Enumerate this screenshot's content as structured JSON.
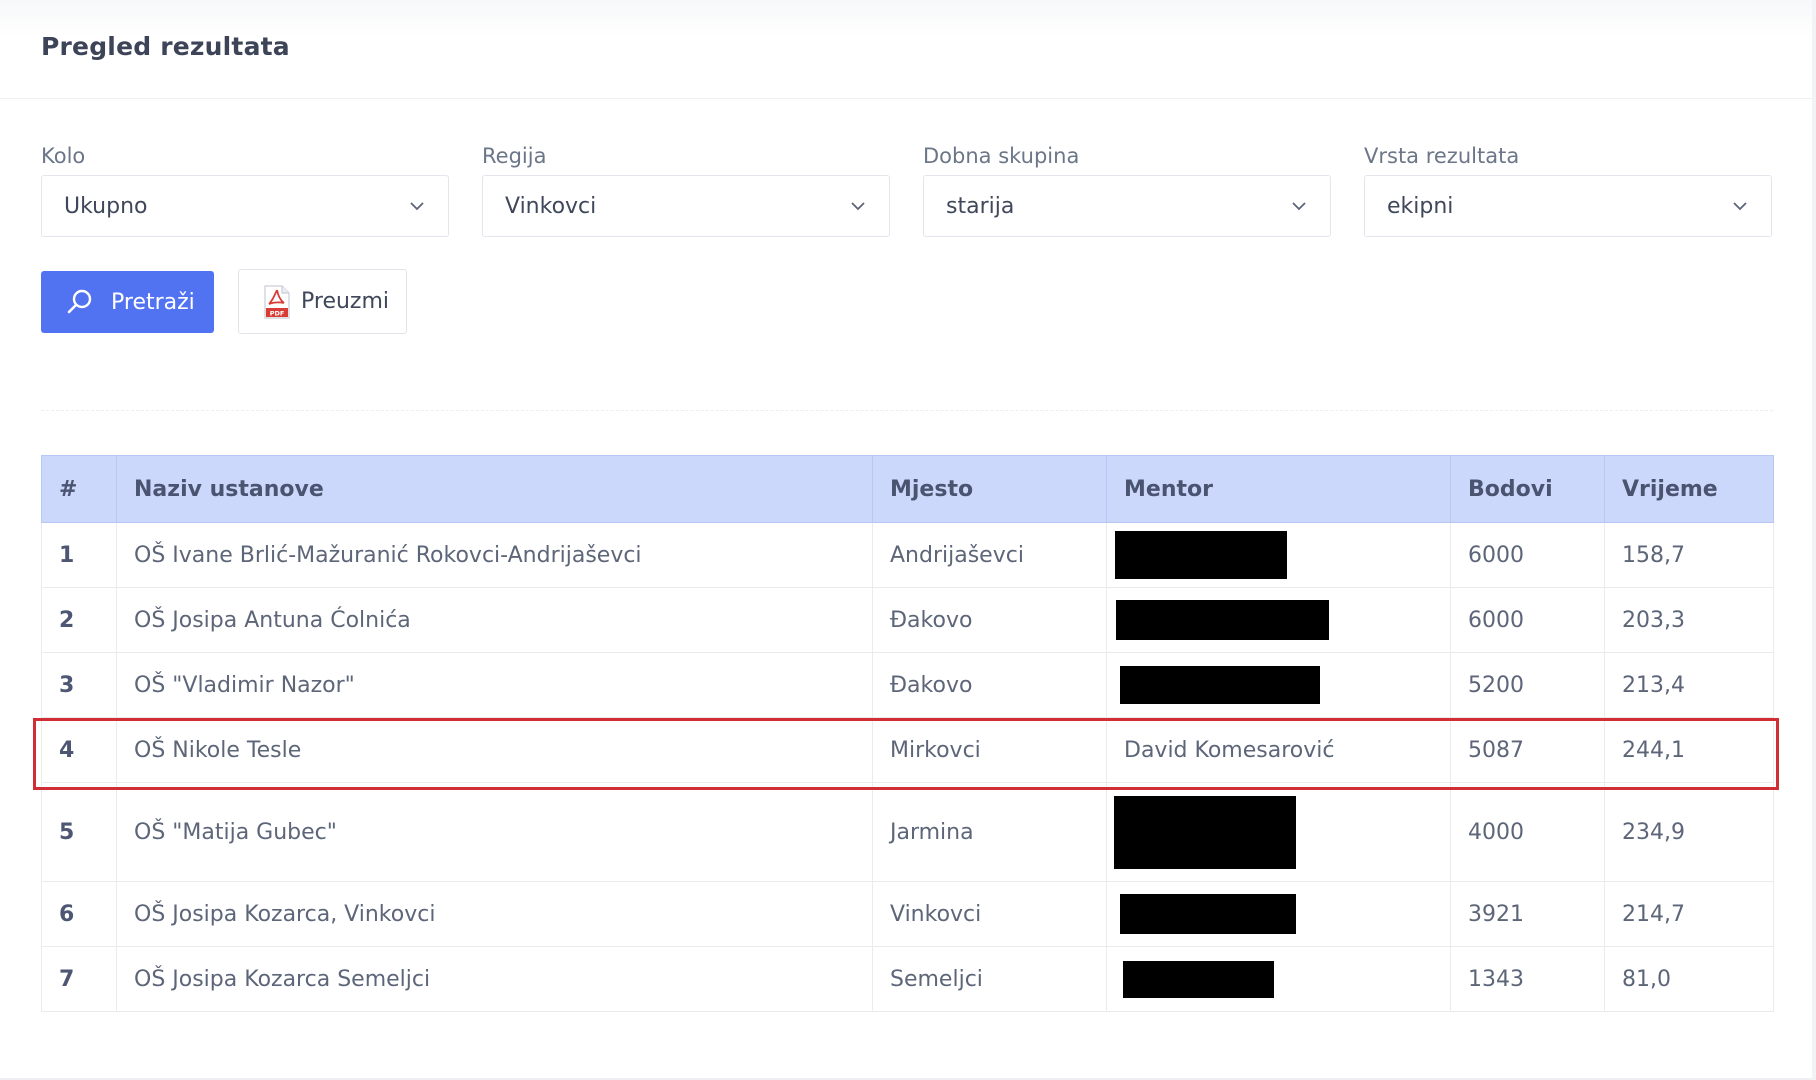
{
  "page": {
    "title": "Pregled rezultata"
  },
  "filters": [
    {
      "label": "Kolo",
      "value": "Ukupno"
    },
    {
      "label": "Regija",
      "value": "Vinkovci"
    },
    {
      "label": "Dobna skupina",
      "value": "starija"
    },
    {
      "label": "Vrsta rezultata",
      "value": "ekipni"
    }
  ],
  "actions": {
    "search_label": "Pretraži",
    "download_label": "Preuzmi",
    "pdf_badge": "PDF"
  },
  "table": {
    "headers": [
      "#",
      "Naziv ustanove",
      "Mjesto",
      "Mentor",
      "Bodovi",
      "Vrijeme"
    ],
    "rows": [
      {
        "rank": "1",
        "name": "OŠ Ivane Brlić-Mažuranić Rokovci-Andrijaševci",
        "place": "Andrijaševci",
        "mentor": "",
        "points": "6000",
        "time": "158,7"
      },
      {
        "rank": "2",
        "name": "OŠ Josipa Antuna Ćolnića",
        "place": "Đakovo",
        "mentor": "",
        "points": "6000",
        "time": "203,3"
      },
      {
        "rank": "3",
        "name": "OŠ \"Vladimir Nazor\"",
        "place": "Đakovo",
        "mentor": "",
        "points": "5200",
        "time": "213,4"
      },
      {
        "rank": "4",
        "name": "OŠ Nikole Tesle",
        "place": "Mirkovci",
        "mentor": "David Komesarović",
        "points": "5087",
        "time": "244,1"
      },
      {
        "rank": "5",
        "name": "OŠ \"Matija Gubec\"",
        "place": "Jarmina",
        "mentor": "",
        "points": "4000",
        "time": "234,9"
      },
      {
        "rank": "6",
        "name": "OŠ Josipa Kozarca, Vinkovci",
        "place": "Vinkovci",
        "mentor": "",
        "points": "3921",
        "time": "214,7"
      },
      {
        "rank": "7",
        "name": "OŠ Josipa Kozarca Semeljci",
        "place": "Semeljci",
        "mentor": "",
        "points": "1343",
        "time": "81,0"
      }
    ]
  },
  "colors": {
    "accent": "#5173f2",
    "table_header": "#ccd8fb",
    "highlight": "#d12d35"
  }
}
